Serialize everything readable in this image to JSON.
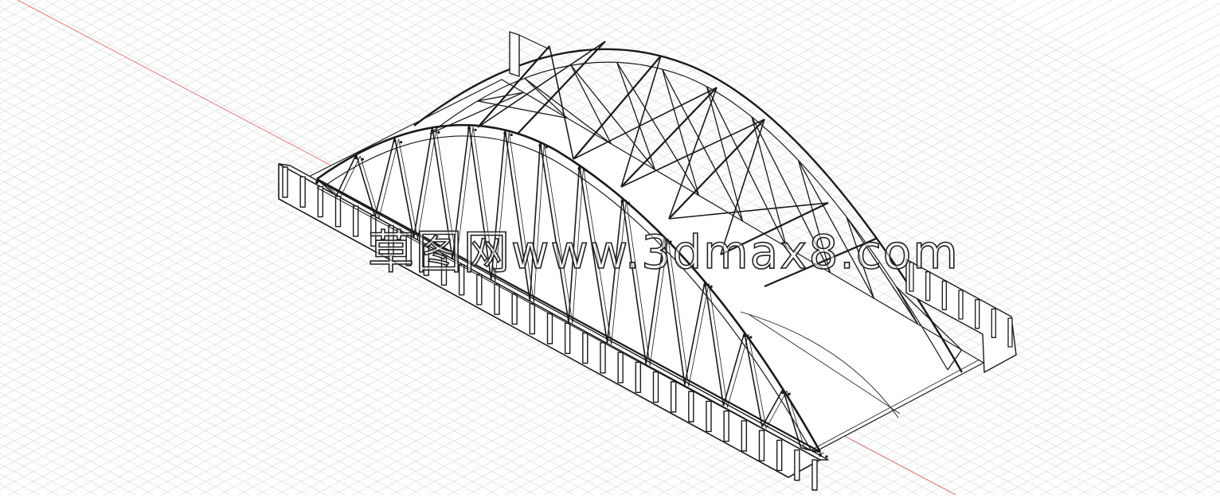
{
  "viewport": {
    "background": "#ffffff",
    "grid_color": "#dcdcdc",
    "axis_color": "#e07a7a",
    "line_color": "#1a1a1a"
  },
  "model": {
    "name": "steel arch truss bridge"
  },
  "watermark": {
    "text": "草图网www.3dmax8.com"
  }
}
